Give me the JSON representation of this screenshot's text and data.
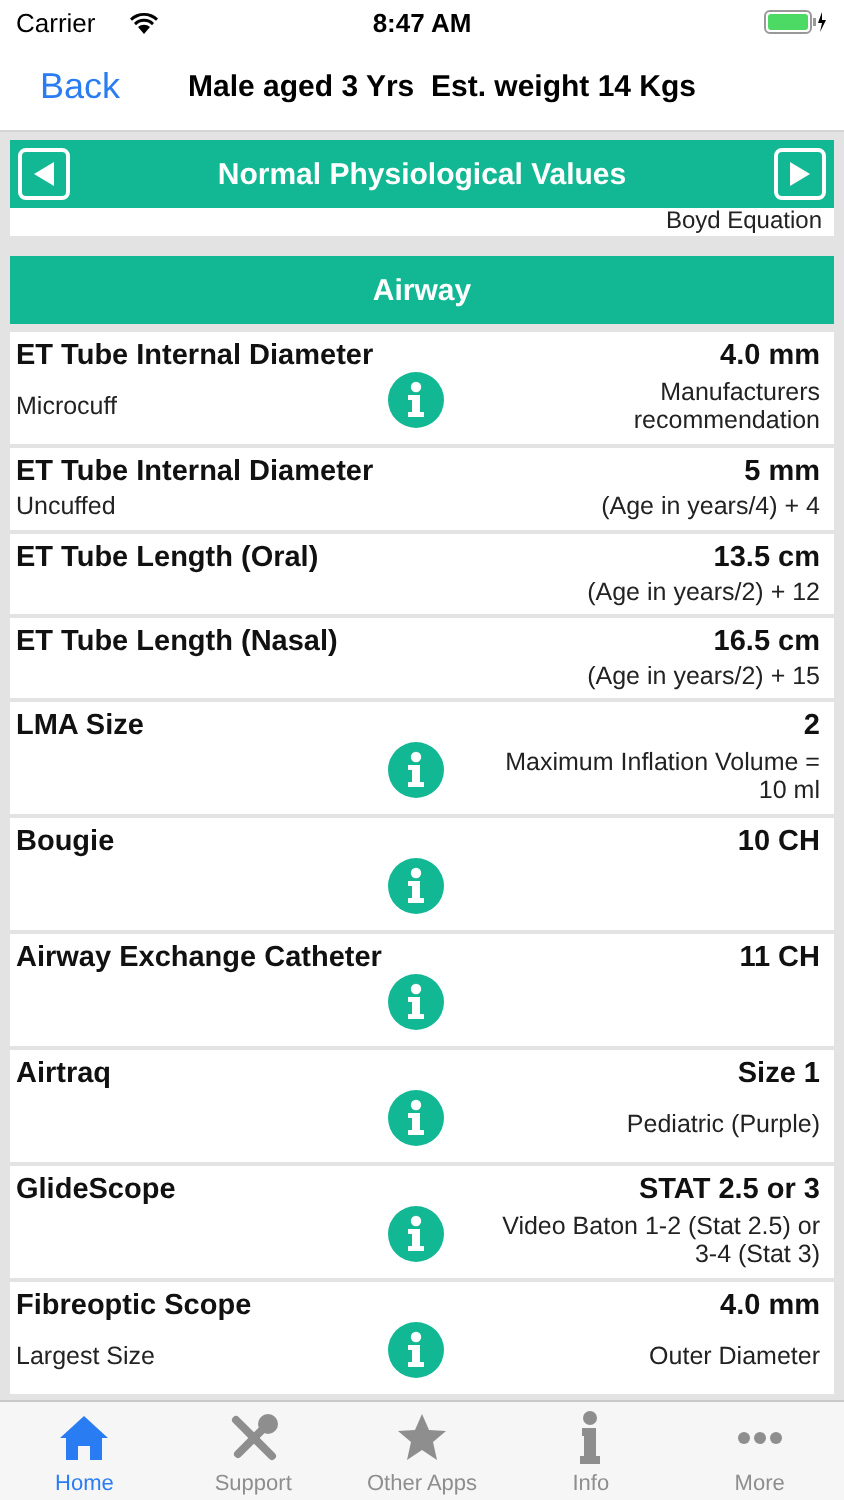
{
  "status_bar": {
    "carrier": "Carrier",
    "time": "8:47 AM"
  },
  "nav": {
    "back": "Back",
    "title": "Male aged 3 Yrs  Est. weight 14 Kgs"
  },
  "section_header": {
    "title": "Normal Physiological Values"
  },
  "previous_note": "Boyd Equation",
  "group_header": "Airway",
  "rows": [
    {
      "name": "ET Tube Internal Diameter",
      "value": "4.0 mm",
      "sub": "Microcuff",
      "info": true,
      "note": "Manufacturers recommendation"
    },
    {
      "name": "ET Tube Internal Diameter",
      "value": "5 mm",
      "sub": "Uncuffed",
      "info": false,
      "note": "(Age in years/4) + 4"
    },
    {
      "name": "ET Tube Length (Oral)",
      "value": "13.5 cm",
      "info": false,
      "note": "(Age in years/2) + 12"
    },
    {
      "name": "ET Tube Length (Nasal)",
      "value": "16.5 cm",
      "info": false,
      "note": "(Age in years/2) + 15"
    },
    {
      "name": "LMA Size",
      "value": "2",
      "info": true,
      "note": "Maximum Inflation Volume = 10 ml"
    },
    {
      "name": "Bougie",
      "value": "10 CH",
      "info": true
    },
    {
      "name": "Airway Exchange Catheter",
      "value": "11 CH",
      "info": true
    },
    {
      "name": "Airtraq",
      "value": "Size 1",
      "info": true,
      "note": "Pediatric (Purple)"
    },
    {
      "name": "GlideScope",
      "value": "STAT 2.5 or 3",
      "info": true,
      "note": "Video Baton 1-2 (Stat 2.5) or 3-4 (Stat 3)"
    },
    {
      "name": "Fibreoptic Scope",
      "value": "4.0 mm",
      "sub": "Largest Size",
      "info": true,
      "note": "Outer Diameter"
    }
  ],
  "tabs": [
    {
      "kind": "home",
      "label": "Home",
      "selected": true
    },
    {
      "kind": "support",
      "label": "Support",
      "selected": false
    },
    {
      "kind": "apps",
      "label": "Other Apps",
      "selected": false
    },
    {
      "kind": "info",
      "label": "Info",
      "selected": false
    },
    {
      "kind": "more",
      "label": "More",
      "selected": false
    }
  ]
}
